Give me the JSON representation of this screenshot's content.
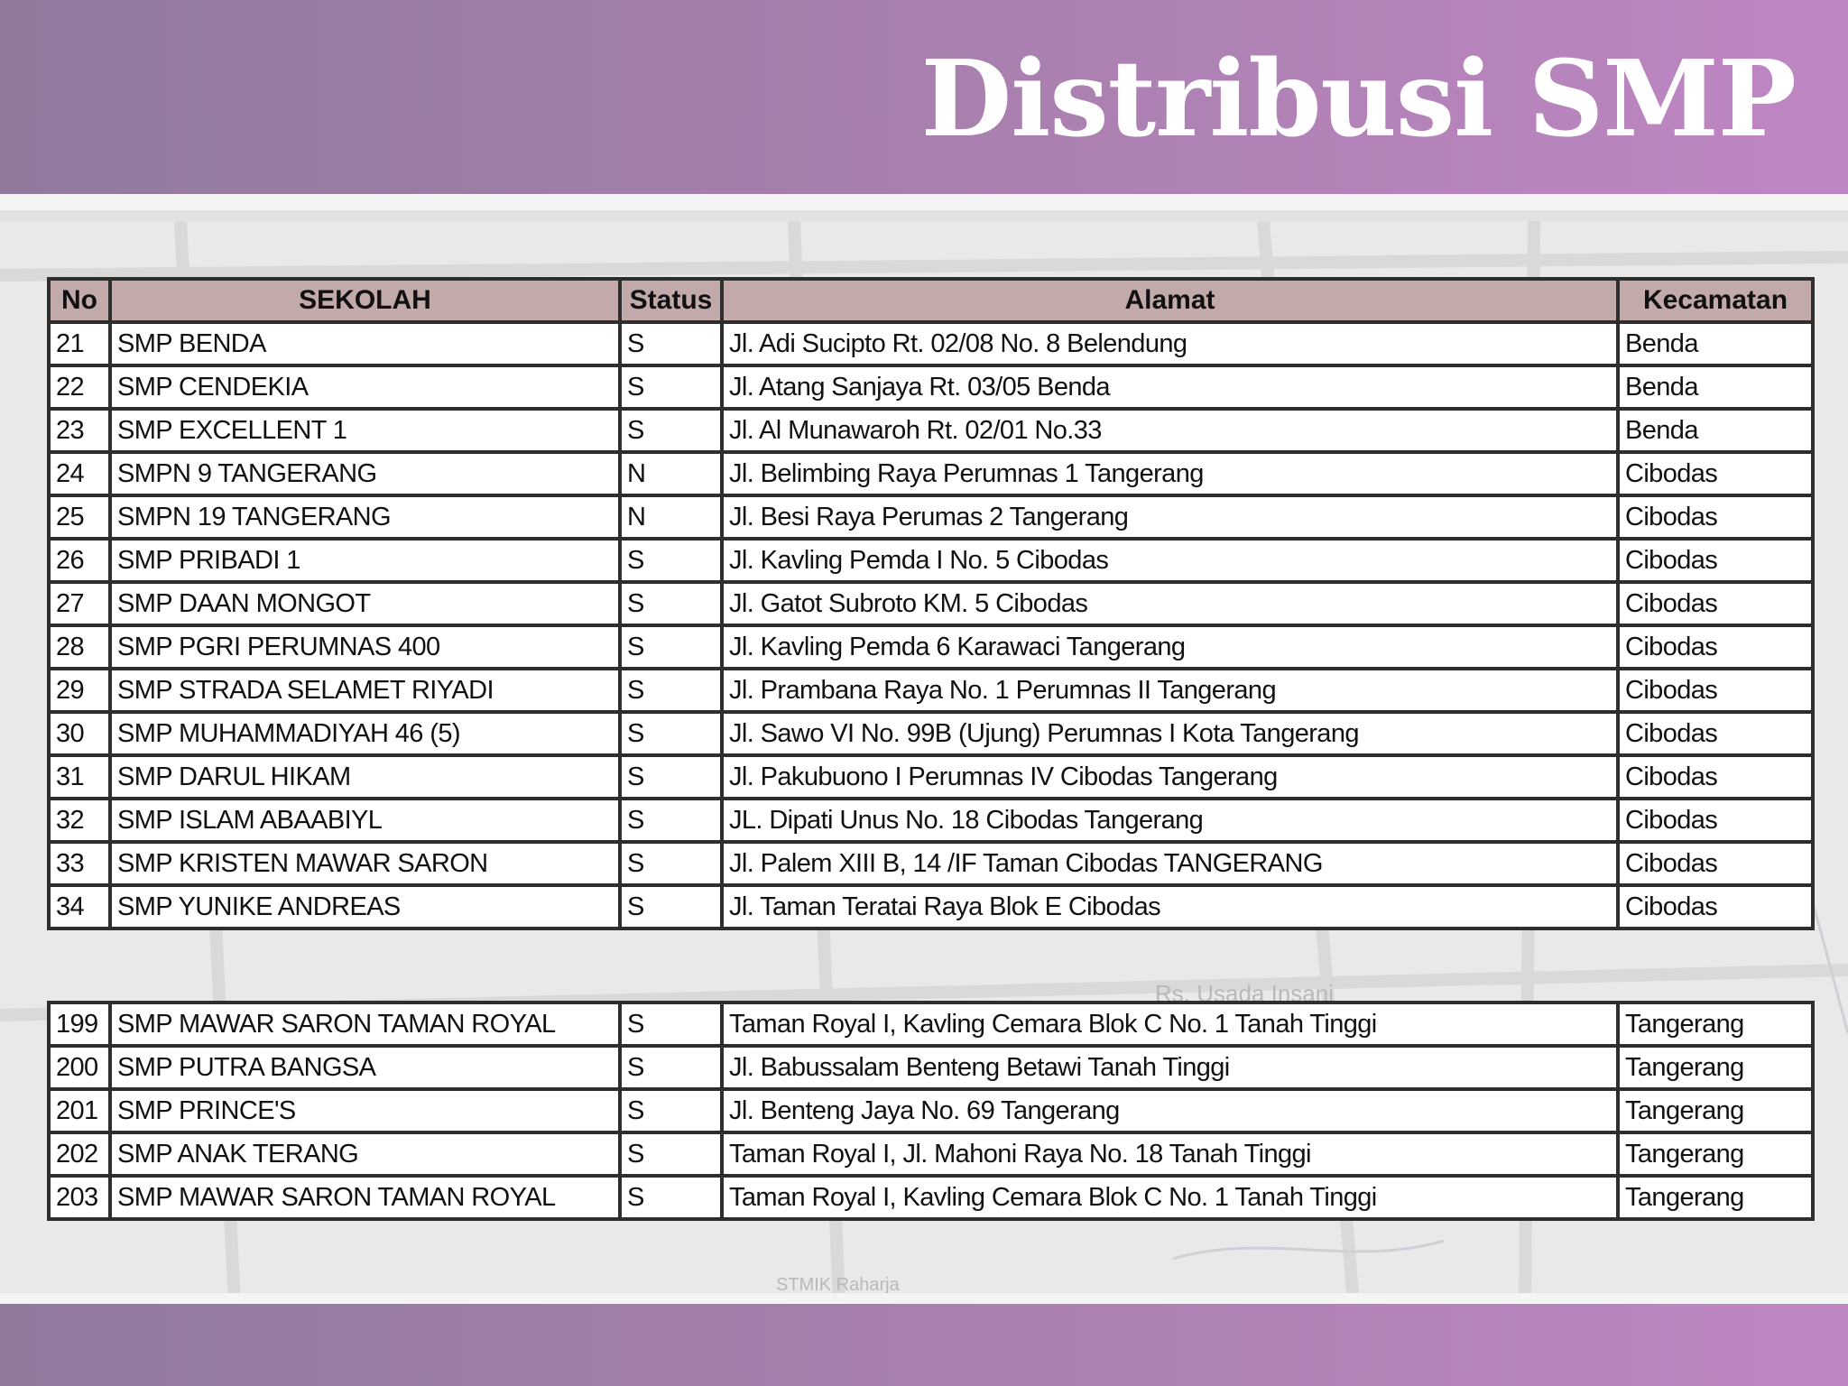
{
  "slide": {
    "title": "Distribusi SMP"
  },
  "table": {
    "headers": [
      "No",
      "SEKOLAH",
      "Status",
      "Alamat",
      "Kecamatan"
    ],
    "rows_top": [
      [
        "21",
        "SMP BENDA",
        "S",
        "Jl. Adi Sucipto Rt. 02/08 No. 8 Belendung",
        "Benda"
      ],
      [
        "22",
        "SMP CENDEKIA",
        "S",
        "Jl. Atang Sanjaya Rt. 03/05 Benda",
        "Benda"
      ],
      [
        "23",
        "SMP EXCELLENT 1",
        "S",
        "Jl. Al Munawaroh Rt. 02/01 No.33",
        "Benda"
      ],
      [
        "24",
        "SMPN 9 TANGERANG",
        "N",
        "Jl. Belimbing Raya Perumnas 1 Tangerang",
        "Cibodas"
      ],
      [
        "25",
        "SMPN 19 TANGERANG",
        "N",
        "Jl. Besi Raya Perumas 2 Tangerang",
        "Cibodas"
      ],
      [
        "26",
        "SMP PRIBADI 1",
        "S",
        "Jl. Kavling Pemda I No. 5 Cibodas",
        "Cibodas"
      ],
      [
        "27",
        "SMP DAAN MONGOT",
        "S",
        "Jl. Gatot Subroto KM. 5 Cibodas",
        "Cibodas"
      ],
      [
        "28",
        "SMP PGRI PERUMNAS 400",
        "S",
        "Jl. Kavling Pemda 6 Karawaci Tangerang",
        "Cibodas"
      ],
      [
        "29",
        "SMP STRADA SELAMET RIYADI",
        "S",
        "Jl. Prambana Raya No. 1 Perumnas II Tangerang",
        "Cibodas"
      ],
      [
        "30",
        "SMP MUHAMMADIYAH 46 (5)",
        "S",
        "Jl. Sawo VI No. 99B (Ujung) Perumnas I Kota Tangerang",
        "Cibodas"
      ],
      [
        "31",
        "SMP DARUL HIKAM",
        "S",
        "Jl. Pakubuono I Perumnas IV Cibodas Tangerang",
        "Cibodas"
      ],
      [
        "32",
        "SMP ISLAM ABAABIYL",
        "S",
        "JL. Dipati Unus No. 18 Cibodas Tangerang",
        "Cibodas"
      ],
      [
        "33",
        "SMP KRISTEN MAWAR SARON",
        "S",
        "Jl. Palem XIII B, 14 /IF Taman Cibodas TANGERANG",
        "Cibodas"
      ],
      [
        "34",
        "SMP YUNIKE ANDREAS",
        "S",
        "Jl. Taman Teratai Raya Blok E Cibodas",
        "Cibodas"
      ]
    ],
    "rows_bottom": [
      [
        "199",
        "SMP MAWAR SARON TAMAN ROYAL",
        "S",
        "Taman Royal I, Kavling Cemara Blok C No. 1 Tanah Tinggi",
        "Tangerang"
      ],
      [
        "200",
        "SMP PUTRA BANGSA",
        "S",
        "Jl. Babussalam Benteng Betawi Tanah Tinggi",
        "Tangerang"
      ],
      [
        "201",
        "SMP PRINCE'S",
        "S",
        "Jl. Benteng Jaya No. 69 Tangerang",
        "Tangerang"
      ],
      [
        "202",
        "SMP ANAK TERANG",
        "S",
        "Taman Royal I, Jl. Mahoni Raya No. 18 Tanah Tinggi",
        "Tangerang"
      ],
      [
        "203",
        "SMP MAWAR SARON TAMAN ROYAL",
        "S",
        "Taman Royal I, Kavling Cemara Blok C No. 1 Tanah Tinggi",
        "Tangerang"
      ]
    ]
  },
  "map_labels": {
    "label_1": "Rs. Usada Insani",
    "label_2": "STMIK Raharja"
  }
}
